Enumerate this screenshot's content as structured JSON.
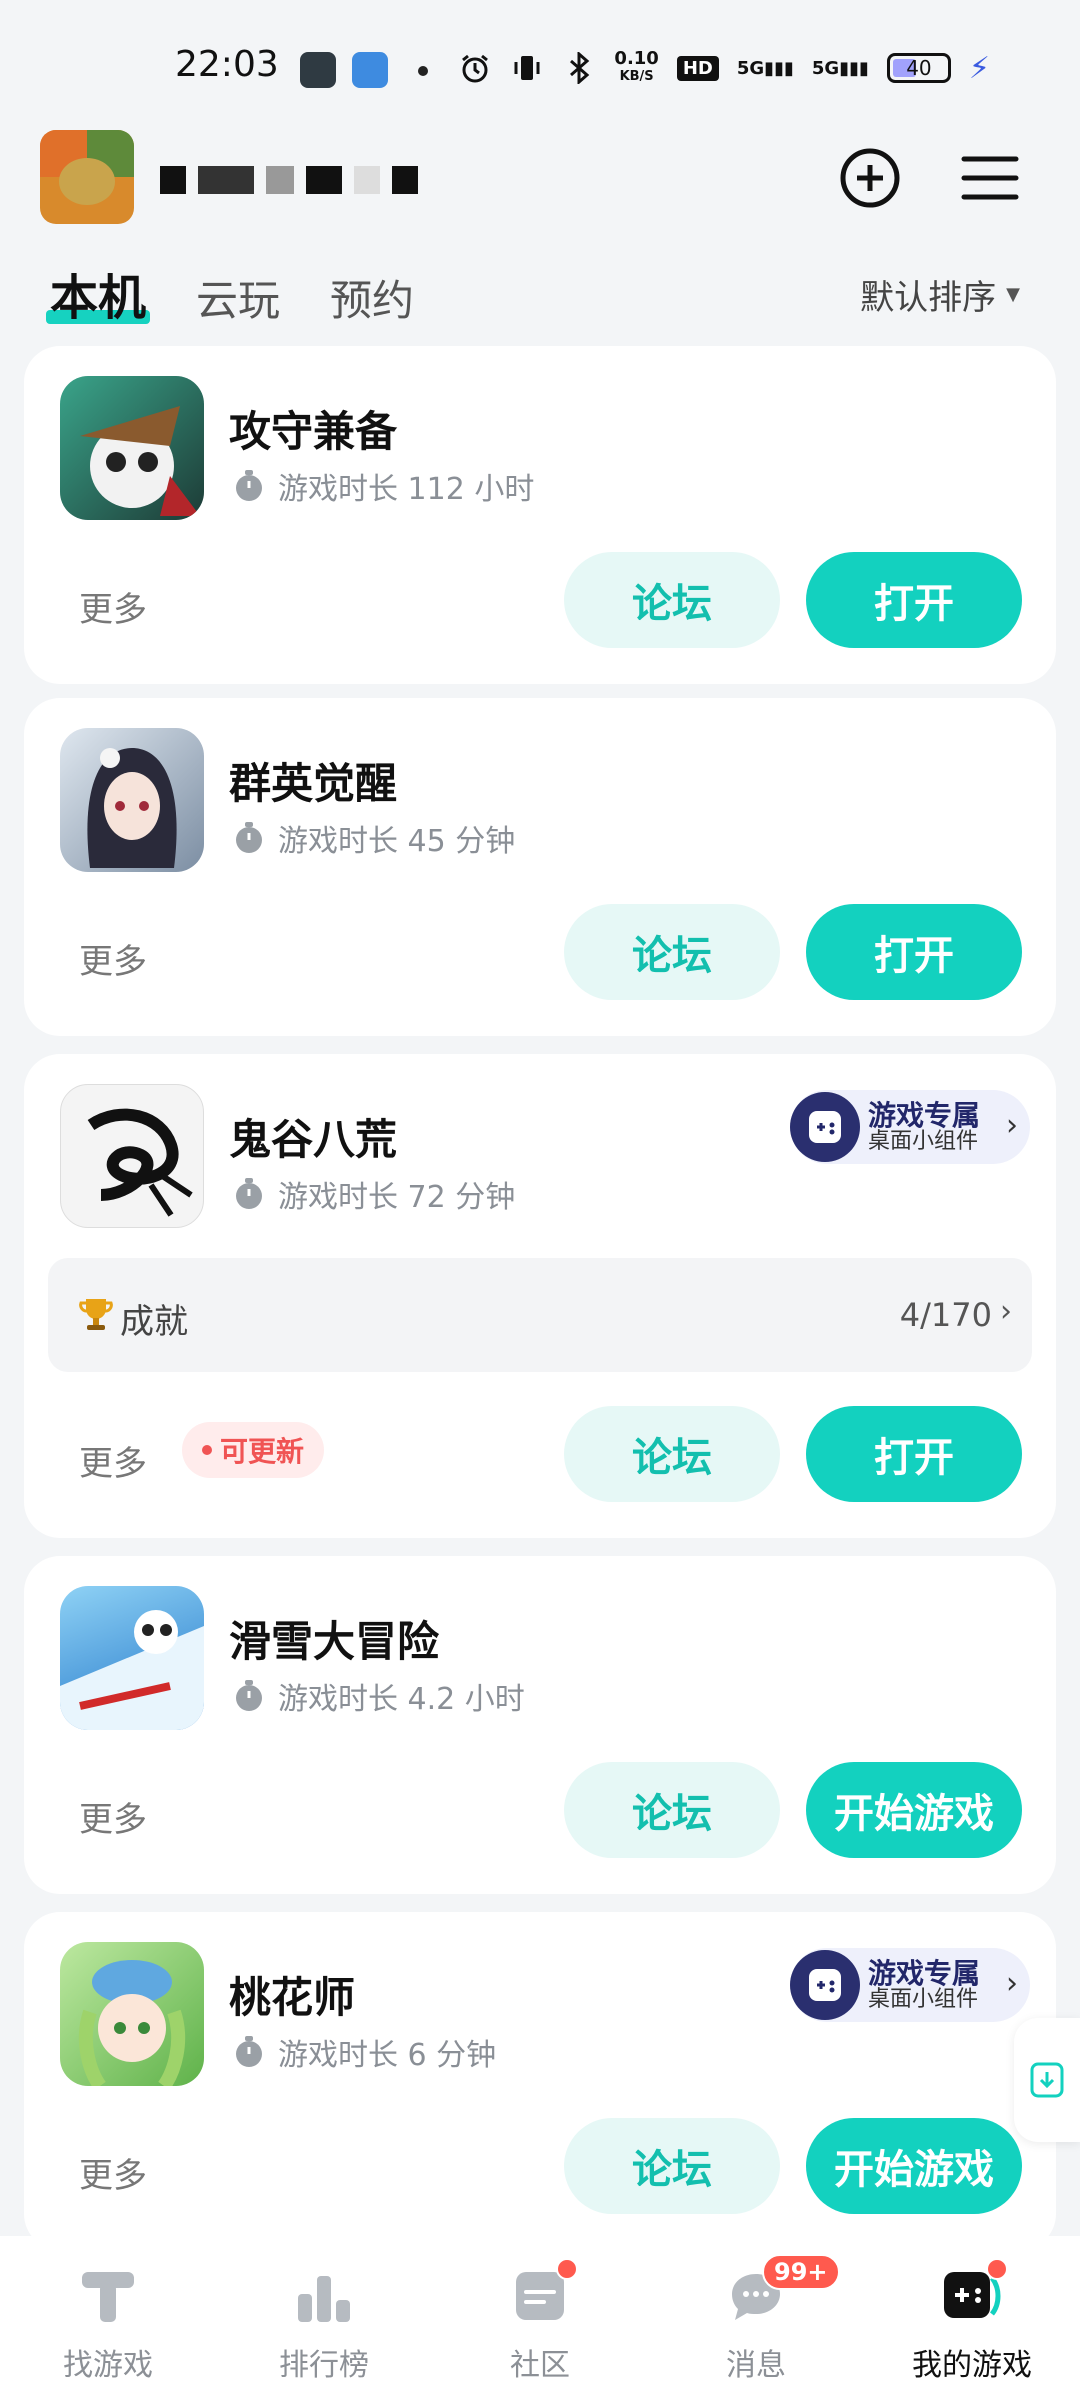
{
  "status_bar": {
    "time": "22:03",
    "net_speed_top": "0.10",
    "net_speed_unit": "KB/S",
    "hd_label": "HD",
    "signal1": "5G",
    "signal2": "5G",
    "battery": "40"
  },
  "tabs": [
    {
      "label": "本机"
    },
    {
      "label": "云玩"
    },
    {
      "label": "预约"
    }
  ],
  "sort_label": "默认排序",
  "games": [
    {
      "title": "攻守兼备",
      "playtime": "游戏时长 112 小时",
      "more": "更多",
      "forum": "论坛",
      "action": "打开"
    },
    {
      "title": "群英觉醒",
      "playtime": "游戏时长 45 分钟",
      "more": "更多",
      "forum": "论坛",
      "action": "打开"
    },
    {
      "title": "鬼谷八荒",
      "playtime": "游戏时长 72 分钟",
      "more": "更多",
      "forum": "论坛",
      "action": "打开",
      "widget_line1": "游戏专属",
      "widget_line2": "桌面小组件",
      "achievement_label": "成就",
      "achievement_count": "4/170",
      "update_label": "可更新"
    },
    {
      "title": "滑雪大冒险",
      "playtime": "游戏时长 4.2 小时",
      "more": "更多",
      "forum": "论坛",
      "action": "开始游戏"
    },
    {
      "title": "桃花师",
      "playtime": "游戏时长 6 分钟",
      "more": "更多",
      "forum": "论坛",
      "action": "开始游戏",
      "widget_line1": "游戏专属",
      "widget_line2": "桌面小组件"
    }
  ],
  "bottom_nav": [
    {
      "label": "找游戏"
    },
    {
      "label": "排行榜"
    },
    {
      "label": "社区"
    },
    {
      "label": "消息",
      "badge": "99+"
    },
    {
      "label": "我的游戏"
    }
  ],
  "colors": {
    "accent": "#13d1bf",
    "accent_light": "#e6f8f6",
    "badge_red": "#ff5a4e",
    "widget_navy": "#22276a"
  }
}
